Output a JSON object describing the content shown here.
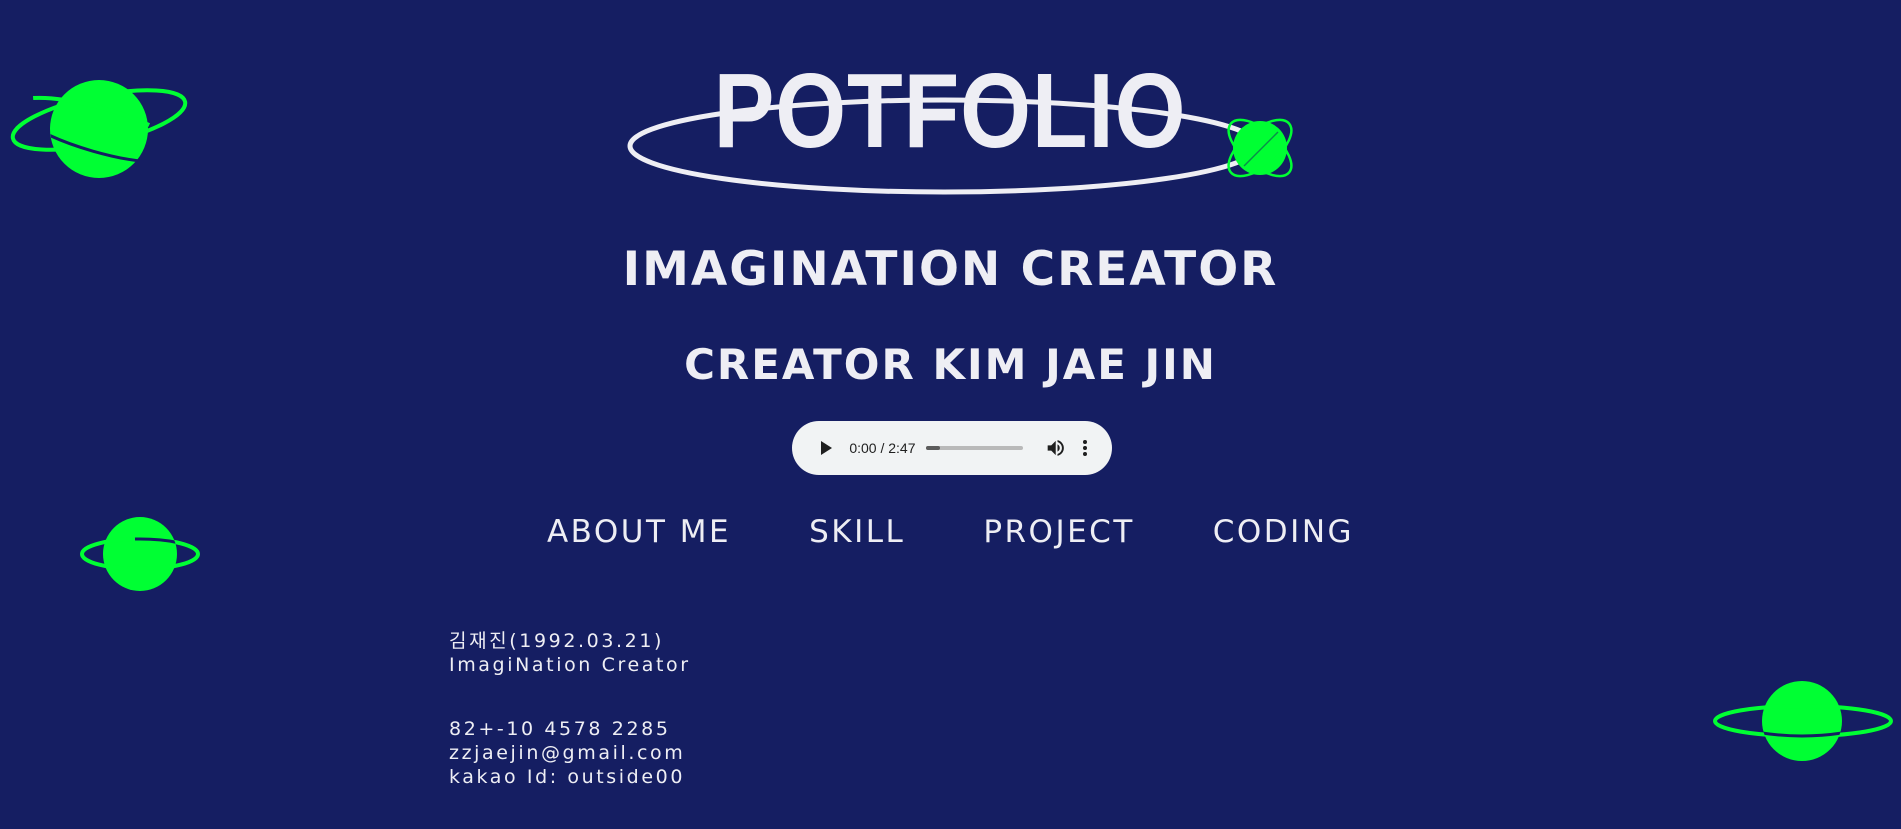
{
  "header": {
    "logo_title": "POTFOLIO",
    "headline_1": "IMAGINATION CREATOR",
    "headline_2": "CREATOR KIM JAE JIN"
  },
  "audio": {
    "time": "0:00 / 2:47",
    "progress_fraction": 0.0,
    "play_icon": "play-icon",
    "volume_icon": "volume-icon",
    "menu_icon": "more-options-icon"
  },
  "nav": {
    "items": [
      {
        "label": "ABOUT ME"
      },
      {
        "label": "SKILL"
      },
      {
        "label": "PROJECT"
      },
      {
        "label": "CODING"
      }
    ]
  },
  "profile": {
    "name_line": "김재진(1992.03.21)",
    "role_line": "ImagiNation Creator",
    "phone": "82+-10 4578 2285",
    "email": "zzjaejin@gmail.com",
    "kakao": "kakao Id: outside00"
  },
  "colors": {
    "background": "#151e62",
    "planet": "#00ff33",
    "text": "#eeeef4"
  }
}
